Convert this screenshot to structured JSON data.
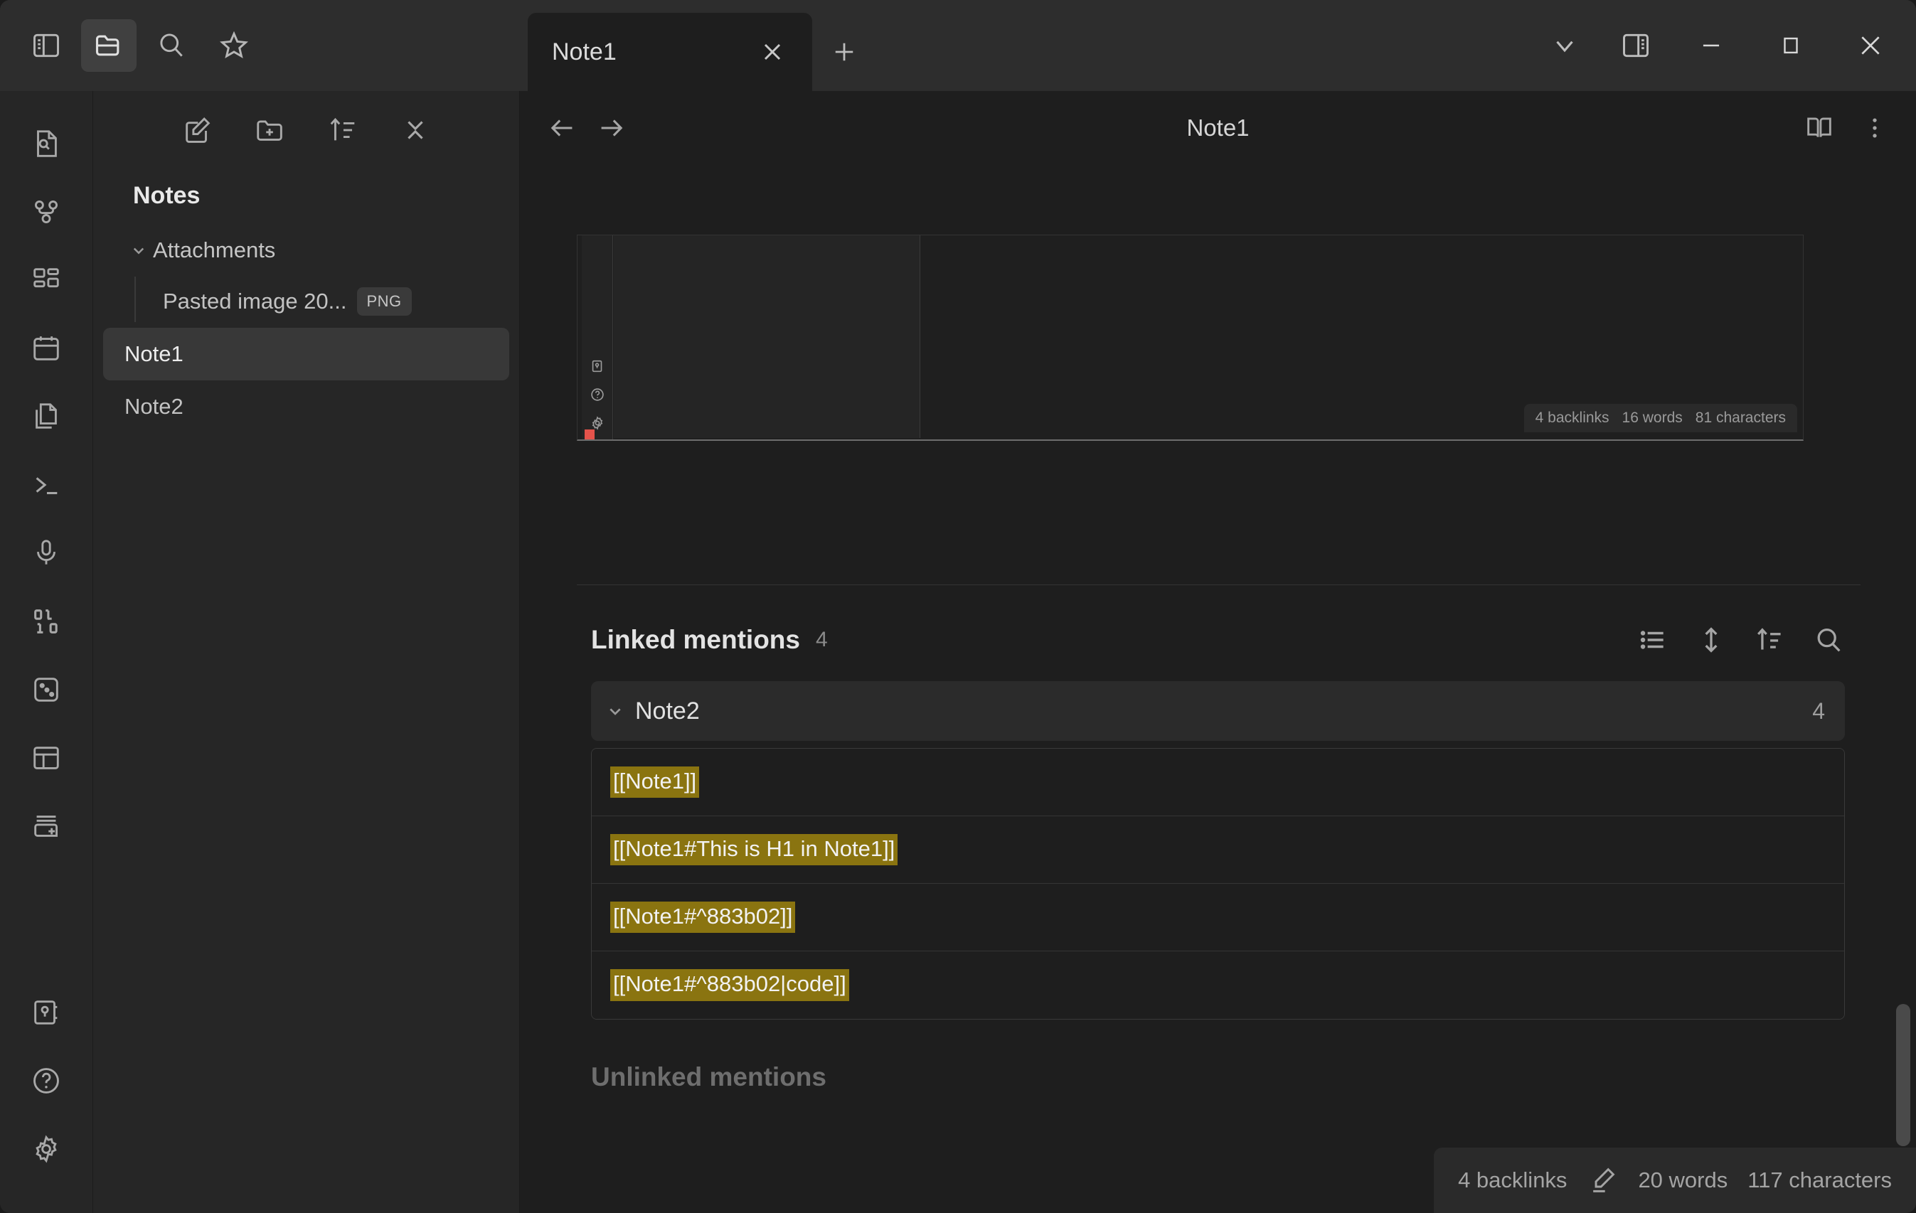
{
  "app": {
    "name": "Obsidian"
  },
  "titlebar": {
    "left_icons": [
      {
        "name": "toggle-left-sidebar-icon",
        "label": "Toggle left sidebar",
        "active": false
      },
      {
        "name": "files-icon",
        "label": "Files",
        "active": true
      },
      {
        "name": "search-icon",
        "label": "Search",
        "active": false
      },
      {
        "name": "bookmarks-icon",
        "label": "Bookmarks",
        "active": false
      }
    ],
    "tabs": [
      {
        "label": "Note1",
        "active": true,
        "close_label": "Close tab"
      }
    ],
    "new_tab_label": "New tab",
    "right_icons": [
      {
        "name": "tab-list-chevron-icon",
        "label": "Show all tabs"
      },
      {
        "name": "toggle-right-sidebar-icon",
        "label": "Toggle right sidebar"
      }
    ],
    "window_controls": [
      {
        "name": "minimize-button",
        "label": "Minimize"
      },
      {
        "name": "maximize-button",
        "label": "Maximize"
      },
      {
        "name": "close-button",
        "label": "Close"
      }
    ]
  },
  "ribbon": {
    "items": [
      {
        "name": "quick-switcher-icon",
        "label": "Quick switcher"
      },
      {
        "name": "graph-view-icon",
        "label": "Open graph view"
      },
      {
        "name": "canvas-icon",
        "label": "Create new canvas"
      },
      {
        "name": "daily-note-icon",
        "label": "Open today's daily note"
      },
      {
        "name": "copy-file-icon",
        "label": "Templates"
      },
      {
        "name": "terminal-icon",
        "label": "Open command palette"
      },
      {
        "name": "microphone-icon",
        "label": "Start recording"
      },
      {
        "name": "binary-icon",
        "label": "Slides"
      },
      {
        "name": "dice-icon",
        "label": "Random note"
      },
      {
        "name": "layout-icon",
        "label": "Workspaces"
      },
      {
        "name": "new-card-icon",
        "label": "New from template"
      }
    ],
    "bottom_items": [
      {
        "name": "vault-switcher-icon",
        "label": "Open another vault"
      },
      {
        "name": "help-icon",
        "label": "Help"
      },
      {
        "name": "settings-icon",
        "label": "Settings"
      }
    ]
  },
  "explorer": {
    "toolbar": [
      {
        "name": "new-note-icon",
        "label": "New note"
      },
      {
        "name": "new-folder-icon",
        "label": "New folder"
      },
      {
        "name": "sort-icon",
        "label": "Change sort order"
      },
      {
        "name": "collapse-all-icon",
        "label": "Collapse all"
      }
    ],
    "vault_name": "Notes",
    "folders": [
      {
        "name": "Attachments",
        "expanded": true,
        "children": [
          {
            "name": "Pasted image 20...",
            "badge": "PNG"
          }
        ]
      }
    ],
    "files": [
      {
        "name": "Note1",
        "selected": true
      },
      {
        "name": "Note2",
        "selected": false
      }
    ]
  },
  "view": {
    "back_label": "Back",
    "forward_label": "Forward",
    "title": "Note1",
    "reading_view_label": "Open in reading view",
    "more_options_label": "More options"
  },
  "embed": {
    "status": {
      "backlinks": "4 backlinks",
      "words": "16 words",
      "characters": "81 characters"
    },
    "rail_icons": [
      {
        "name": "vault-switcher-icon"
      },
      {
        "name": "help-icon"
      },
      {
        "name": "settings-icon"
      }
    ]
  },
  "backlinks": {
    "title": "Linked mentions",
    "count": "4",
    "tools": [
      {
        "name": "show-more-context-icon",
        "label": "Show more context"
      },
      {
        "name": "collapse-results-icon",
        "label": "Collapse results"
      },
      {
        "name": "change-sort-order-icon",
        "label": "Change sort order"
      },
      {
        "name": "search-backlinks-icon",
        "label": "Search"
      }
    ],
    "groups": [
      {
        "name": "Note2",
        "count": "4",
        "expanded": true,
        "results": [
          {
            "text": "[[Note1]]"
          },
          {
            "text": "[[Note1#This is H1 in Note1]]"
          },
          {
            "text": "[[Note1#^883b02]]"
          },
          {
            "text": "[[Note1#^883b02|code]]"
          }
        ]
      }
    ],
    "unlinked_title": "Unlinked mentions"
  },
  "statusbar": {
    "backlinks": "4 backlinks",
    "edit_icon_label": "Editing mode",
    "words": "20 words",
    "characters": "117 characters"
  },
  "colors": {
    "accent": "#8a7410",
    "background": "#1e1e1e",
    "panel": "#262626",
    "titlebar": "#2d2d2d"
  }
}
